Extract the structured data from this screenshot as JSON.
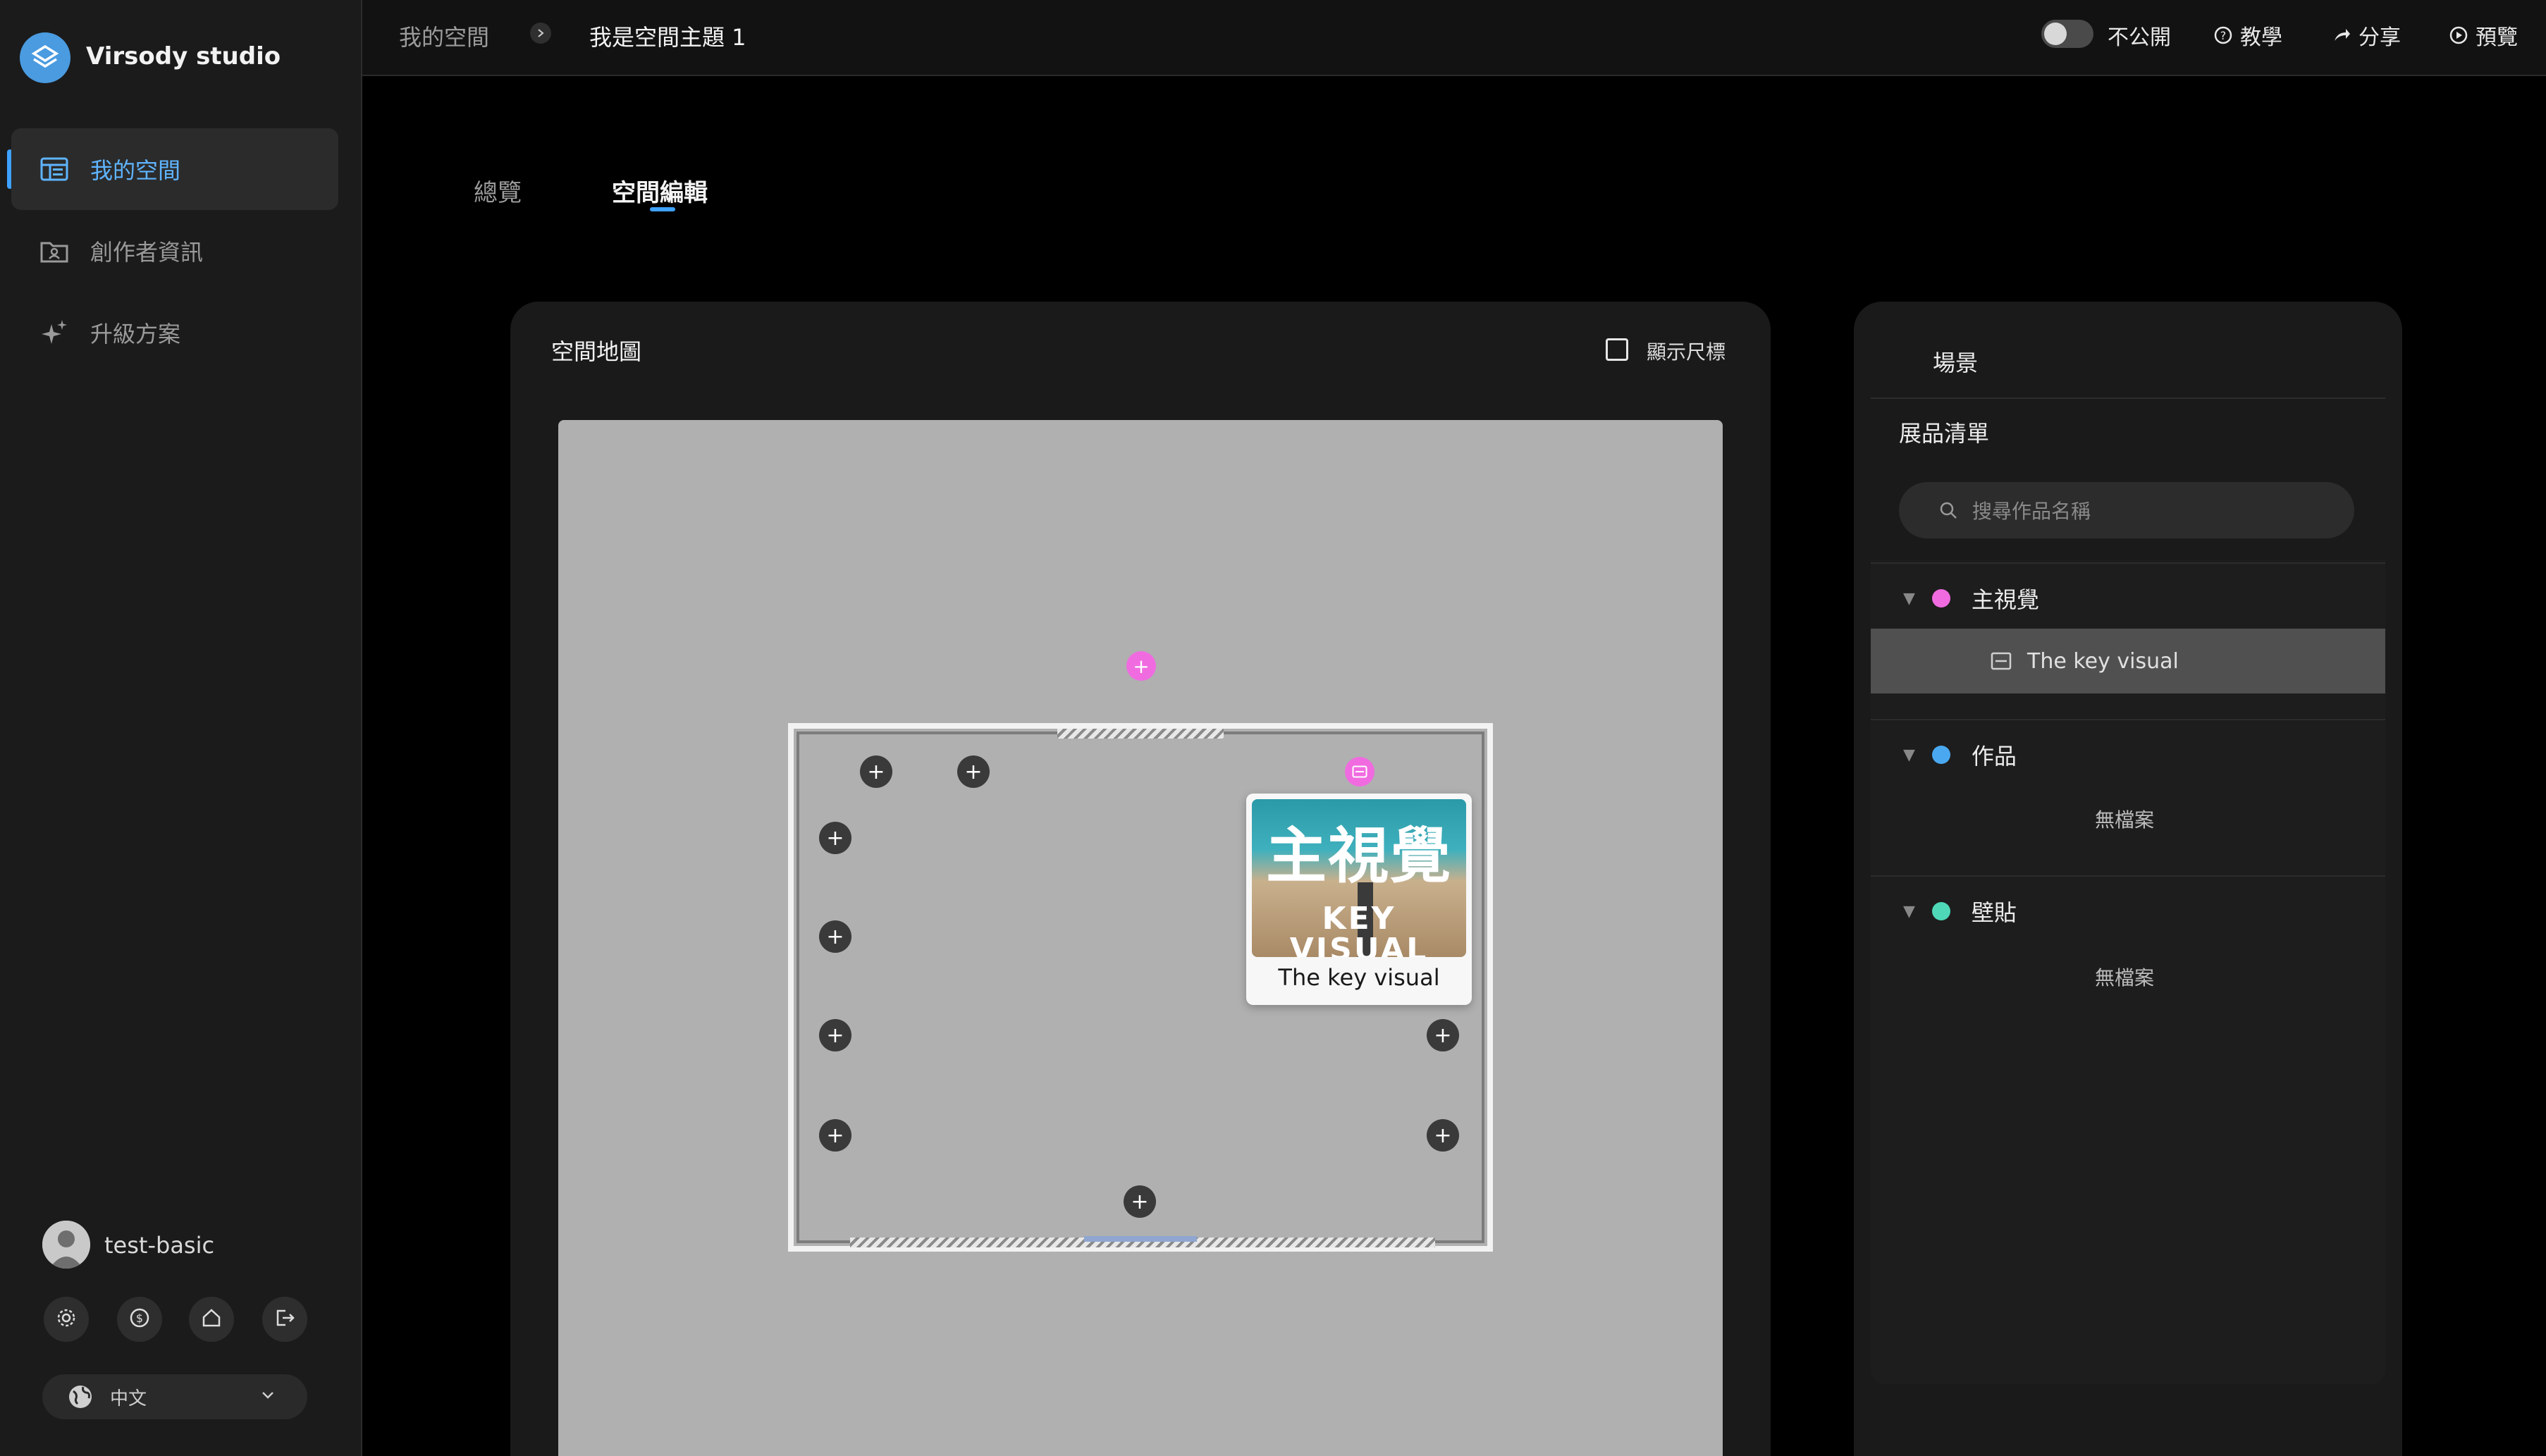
{
  "app": {
    "brand": "Virsody studio"
  },
  "sidebar": {
    "items": [
      {
        "label": "我的空間",
        "icon": "space-icon",
        "active": true
      },
      {
        "label": "創作者資訊",
        "icon": "folder-user-icon",
        "active": false
      },
      {
        "label": "升級方案",
        "icon": "sparkle-icon",
        "active": false
      }
    ],
    "user": {
      "name": "test-basic"
    },
    "footer_icons": [
      "settings-icon",
      "billing-icon",
      "home-icon",
      "logout-icon"
    ],
    "language": {
      "value": "中文"
    }
  },
  "topbar": {
    "breadcrumb": [
      "我的空間",
      "我是空間主題 1"
    ],
    "visibility_label": "不公開",
    "visibility_on": false,
    "tutorial_label": "教學",
    "share_label": "分享",
    "preview_label": "預覽"
  },
  "tabs": [
    {
      "label": "總覽",
      "active": false
    },
    {
      "label": "空間編輯",
      "active": true
    }
  ],
  "map_panel": {
    "title": "空間地圖",
    "show_ruler_label": "顯示尺標",
    "show_ruler_checked": false,
    "key_visual_card": {
      "caption": "The key visual",
      "image_line1": "主視覺",
      "image_line2": "KEY VISUAL"
    }
  },
  "right_panel": {
    "scene_tab": "場景",
    "list_title": "展品清單",
    "search_placeholder": "搜尋作品名稱",
    "categories": [
      {
        "label": "主視覺",
        "color": "#f06be0",
        "items": [
          "The key visual"
        ],
        "empty_label": ""
      },
      {
        "label": "作品",
        "color": "#4aa8f0",
        "items": [],
        "empty_label": "無檔案"
      },
      {
        "label": "壁貼",
        "color": "#4fd8b8",
        "items": [],
        "empty_label": "無檔案"
      }
    ]
  },
  "colors": {
    "accent": "#3ea2ff",
    "pink": "#f06be0",
    "blue": "#4aa8f0",
    "teal": "#4fd8b8"
  }
}
